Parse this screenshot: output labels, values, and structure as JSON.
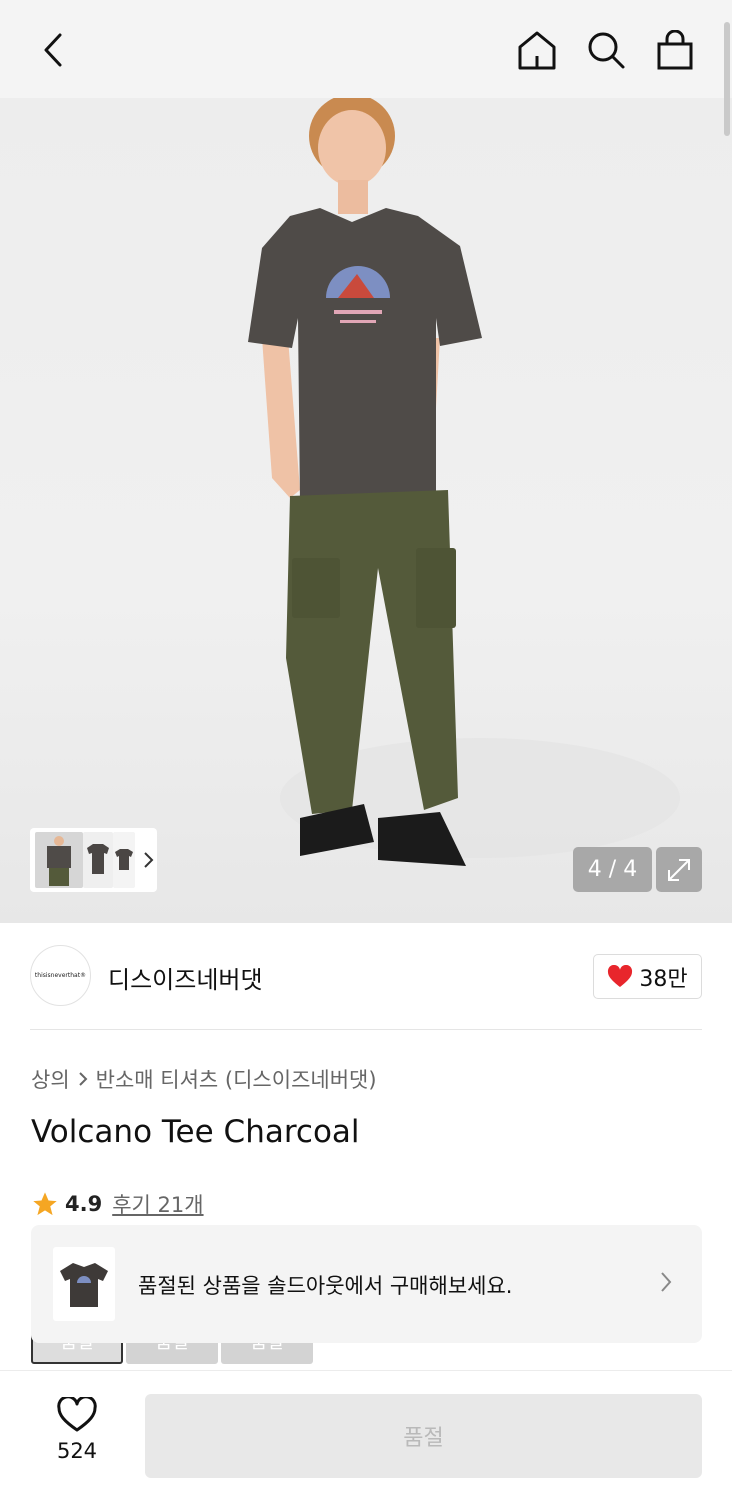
{
  "topbar": {
    "back_icon": "chevron-left-icon",
    "home_icon": "home-icon",
    "search_icon": "search-icon",
    "cart_icon": "shopping-bag-icon"
  },
  "gallery": {
    "pager": "4 / 4",
    "expand_icon": "expand-icon"
  },
  "brand": {
    "logo_text": "thisisneverthat®",
    "name": "디스이즈네버댓",
    "likes": "38만"
  },
  "breadcrumb": {
    "category": "상의",
    "subcategory": "반소매 티셔츠 (디스이즈네버댓)"
  },
  "product": {
    "title": "Volcano Tee Charcoal",
    "rating": "4.9",
    "reviews": "후기 21개"
  },
  "sizes": [
    "품절",
    "품절",
    "품절"
  ],
  "soldout_banner": {
    "text": "품절된 상품을 솔드아웃에서 구매해보세요."
  },
  "bottom": {
    "wish_count": "524",
    "buy_label": "품절"
  },
  "colors": {
    "accent_red": "#e8262c",
    "star": "#f5a623"
  }
}
